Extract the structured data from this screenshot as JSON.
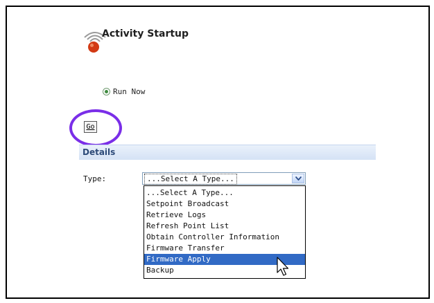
{
  "header": {
    "title": "Activity Startup"
  },
  "run": {
    "radio_label": "Run Now",
    "go_label": "Go"
  },
  "details": {
    "heading": "Details",
    "type_label": "Type:",
    "select_value": "...Select A Type...",
    "options": [
      "...Select A Type...",
      "Setpoint Broadcast",
      "Retrieve Logs",
      "Refresh Point List",
      "Obtain Controller Information",
      "Firmware Transfer",
      "Firmware Apply",
      "Backup"
    ],
    "highlighted_option": "Firmware Apply"
  },
  "colors": {
    "highlight_ring": "#7a2ee8",
    "details_bar": "#d5e2f5",
    "selection": "#316ac5"
  },
  "icons": [
    "activity-logo-icon",
    "chevron-down-icon",
    "mouse-pointer-icon"
  ]
}
